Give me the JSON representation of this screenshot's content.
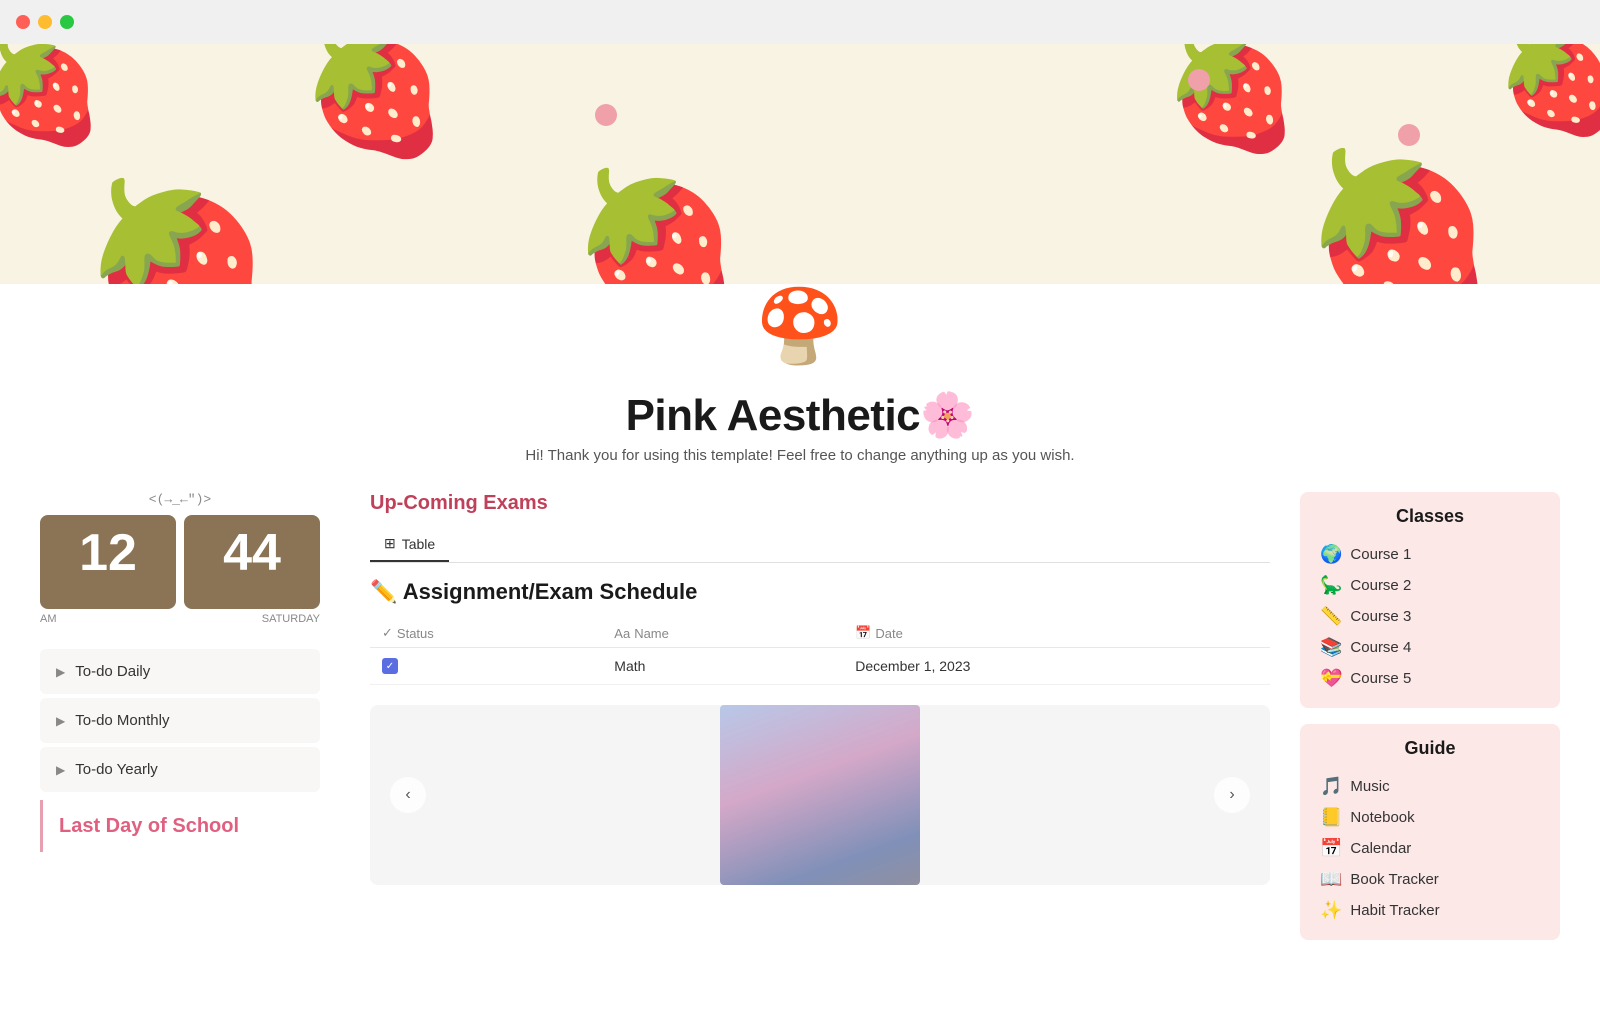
{
  "window": {
    "traffic_lights": [
      "red",
      "yellow",
      "green"
    ]
  },
  "banner": {
    "bg_color": "#f9f3e3",
    "icon": "🍄"
  },
  "page": {
    "title": "Pink Aesthetic🌸",
    "subtitle": "Hi! Thank you for using this template! Feel free to change anything up as you wish.",
    "icon": "🍄"
  },
  "clock": {
    "ascii": "<(→_←\")>",
    "hour": "12",
    "minute": "44",
    "period": "AM",
    "day": "SATURDAY"
  },
  "todo": {
    "items": [
      {
        "label": "To-do Daily",
        "arrow": "▶"
      },
      {
        "label": "To-do Monthly",
        "arrow": "▶"
      },
      {
        "label": "To-do Yearly",
        "arrow": "▶"
      }
    ],
    "last_day_label": "Last Day of School"
  },
  "exams": {
    "section_title": "Up-Coming Exams",
    "table_tab": "Table",
    "db_title": "✏️ Assignment/Exam Schedule",
    "columns": [
      {
        "icon": "✓",
        "label": "Status"
      },
      {
        "icon": "Aa",
        "label": "Name"
      },
      {
        "icon": "📅",
        "label": "Date"
      }
    ],
    "rows": [
      {
        "checked": true,
        "name": "Math",
        "date": "December 1, 2023"
      }
    ]
  },
  "carousel": {
    "prev_label": "‹",
    "next_label": "›"
  },
  "classes": {
    "title": "Classes",
    "items": [
      {
        "icon": "🌍",
        "label": "Course 1"
      },
      {
        "icon": "🦕",
        "label": "Course 2"
      },
      {
        "icon": "📏",
        "label": "Course 3"
      },
      {
        "icon": "📚",
        "label": "Course 4"
      },
      {
        "icon": "💝",
        "label": "Course 5"
      }
    ]
  },
  "guide": {
    "title": "Guide",
    "items": [
      {
        "icon": "🎵",
        "label": "Music"
      },
      {
        "icon": "📒",
        "label": "Notebook"
      },
      {
        "icon": "📅",
        "label": "Calendar"
      },
      {
        "icon": "📖",
        "label": "Book Tracker"
      },
      {
        "icon": "✨",
        "label": "Habit Tracker"
      }
    ]
  }
}
